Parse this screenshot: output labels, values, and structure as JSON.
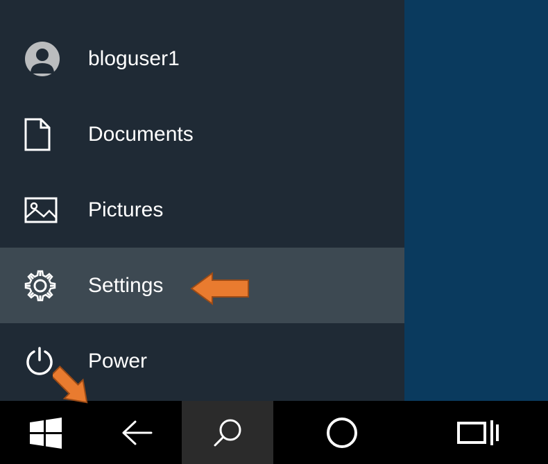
{
  "start_menu": {
    "user": {
      "label": "bloguser1"
    },
    "items": [
      {
        "id": "documents",
        "label": "Documents"
      },
      {
        "id": "pictures",
        "label": "Pictures"
      },
      {
        "id": "settings",
        "label": "Settings",
        "hovered": true
      },
      {
        "id": "power",
        "label": "Power"
      }
    ]
  },
  "taskbar": {
    "buttons": [
      {
        "id": "start",
        "tooltip": "Start"
      },
      {
        "id": "back",
        "tooltip": "Back"
      },
      {
        "id": "search",
        "tooltip": "Search",
        "active": true
      },
      {
        "id": "cortana",
        "tooltip": "Cortana"
      },
      {
        "id": "taskview",
        "tooltip": "Task View"
      }
    ]
  },
  "annotations": {
    "arrow_settings": "pointing-left",
    "arrow_start": "pointing-down-left"
  },
  "colors": {
    "menu_bg": "#1f2a35",
    "menu_hover": "#3d4952",
    "desktop": "#0a3a5e",
    "taskbar": "#000000",
    "arrow": "#e97b2f"
  }
}
